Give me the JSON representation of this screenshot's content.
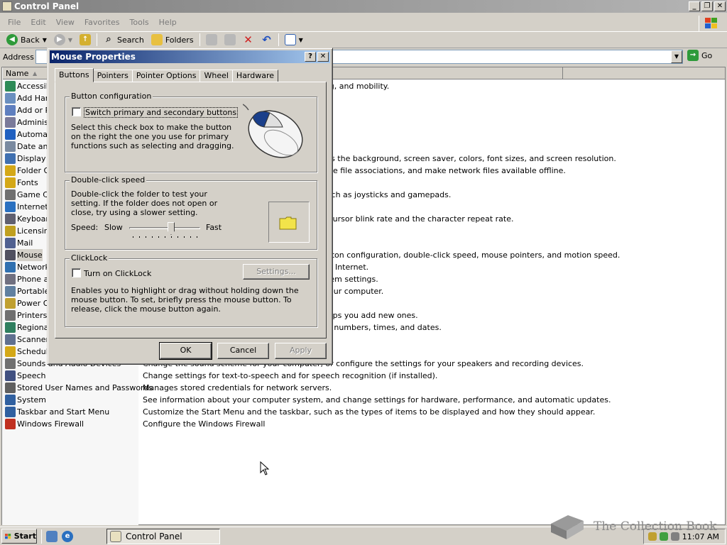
{
  "window": {
    "title": "Control Panel"
  },
  "menu": [
    "File",
    "Edit",
    "View",
    "Favorites",
    "Tools",
    "Help"
  ],
  "toolbar": {
    "back": "Back",
    "search": "Search",
    "folders": "Folders"
  },
  "address": {
    "label": "Address",
    "go": "Go"
  },
  "list": {
    "headers": {
      "name": "Name",
      "comments": ""
    },
    "items": [
      {
        "name": "Accessibility Options",
        "desc": "Adjust your computer settings for vision, hearing, and mobility.",
        "color": "#2e8b57"
      },
      {
        "name": "Add Hardware",
        "desc": "",
        "color": "#6a8fbf"
      },
      {
        "name": "Add or Remove Programs",
        "desc": "",
        "color": "#5f7fbf"
      },
      {
        "name": "Administrative Tools",
        "desc": "",
        "color": "#7a7a9a"
      },
      {
        "name": "Automatic Updates",
        "desc": "",
        "color": "#2060c0"
      },
      {
        "name": "Date and Time",
        "desc": "",
        "color": "#7a8aa0"
      },
      {
        "name": "Display",
        "desc": "Change the appearance of your desktop, such as the background, screen saver, colors, font sizes, and screen resolution.",
        "color": "#4070b0"
      },
      {
        "name": "Folder Options",
        "desc": "Customize the display of files and folders, change file associations, and make network files available offline.",
        "color": "#d4a817"
      },
      {
        "name": "Fonts",
        "desc": "",
        "color": "#d4a817"
      },
      {
        "name": "Game Controllers",
        "desc": "Add, remove, and configure game controllers such as joysticks and gamepads.",
        "color": "#707070"
      },
      {
        "name": "Internet Options",
        "desc": "",
        "color": "#2a70c0"
      },
      {
        "name": "Keyboard",
        "desc": "Customize your keyboard settings, such as the cursor blink rate and the character repeat rate.",
        "color": "#606070"
      },
      {
        "name": "Licensing",
        "desc": "",
        "color": "#c0a020"
      },
      {
        "name": "Mail",
        "desc": "",
        "color": "#506090"
      },
      {
        "name": "Mouse",
        "desc": "Customize your mouse settings, such as the button configuration, double-click speed, mouse pointers, and motion speed.",
        "color": "#505060"
      },
      {
        "name": "Network Connections",
        "desc": "Connects to other computers, networks, and the Internet.",
        "color": "#3070b0"
      },
      {
        "name": "Phone and Modem Options",
        "desc": "Configure your telephone dialing rules and modem settings.",
        "color": "#707080"
      },
      {
        "name": "Portable Media Devices",
        "desc": "Manage portable media devices connected to your computer.",
        "color": "#6080a0"
      },
      {
        "name": "Power Options",
        "desc": "",
        "color": "#c0a030"
      },
      {
        "name": "Printers and Faxes",
        "desc": "Shows installed printers and fax printers and helps you add new ones.",
        "color": "#707070"
      },
      {
        "name": "Regional and Language Options",
        "desc": "Customize settings for the display of languages, numbers, times, and dates.",
        "color": "#2f7f5f"
      },
      {
        "name": "Scanners and Cameras",
        "desc": "",
        "color": "#607090"
      },
      {
        "name": "Scheduled Tasks",
        "desc": "",
        "color": "#d4a817"
      },
      {
        "name": "Sounds and Audio Devices",
        "desc": "Change the sound scheme for your computer, or configure the settings for your speakers and recording devices.",
        "color": "#707070"
      },
      {
        "name": "Speech",
        "desc": "Change settings for text-to-speech and for speech recognition (if installed).",
        "color": "#405080"
      },
      {
        "name": "Stored User Names and Passwords",
        "desc": "Manages stored credentials for network servers.",
        "color": "#606060"
      },
      {
        "name": "System",
        "desc": "See information about your computer system, and change settings for hardware, performance, and automatic updates.",
        "color": "#3060a0"
      },
      {
        "name": "Taskbar and Start Menu",
        "desc": "Customize the Start Menu and the taskbar, such as the types of items to be displayed and how they should appear.",
        "color": "#3060a0"
      },
      {
        "name": "Windows Firewall",
        "desc": "Configure the Windows Firewall",
        "color": "#c03020"
      }
    ]
  },
  "dialog": {
    "title": "Mouse Properties",
    "tabs": [
      "Buttons",
      "Pointers",
      "Pointer Options",
      "Wheel",
      "Hardware"
    ],
    "button_config": {
      "label": "Button configuration",
      "checkbox": "Switch primary and secondary buttons",
      "text": "Select this check box to make the button on the right the one you use for primary functions such as selecting and dragging."
    },
    "double_click": {
      "label": "Double-click speed",
      "text": "Double-click the folder to test your setting. If the folder does not open or close, try using a slower setting.",
      "speed_label": "Speed:",
      "slow": "Slow",
      "fast": "Fast",
      "level": 0.6
    },
    "clicklock": {
      "label": "ClickLock",
      "checkbox": "Turn on ClickLock",
      "settings": "Settings...",
      "text": "Enables you to highlight or drag without holding down the mouse button. To set, briefly press the mouse button. To release, click the mouse button again."
    },
    "ok": "OK",
    "cancel": "Cancel",
    "apply": "Apply"
  },
  "taskbar": {
    "start": "Start",
    "task": "Control Panel",
    "clock": "11:07 AM"
  },
  "watermark": "The Collection Book"
}
